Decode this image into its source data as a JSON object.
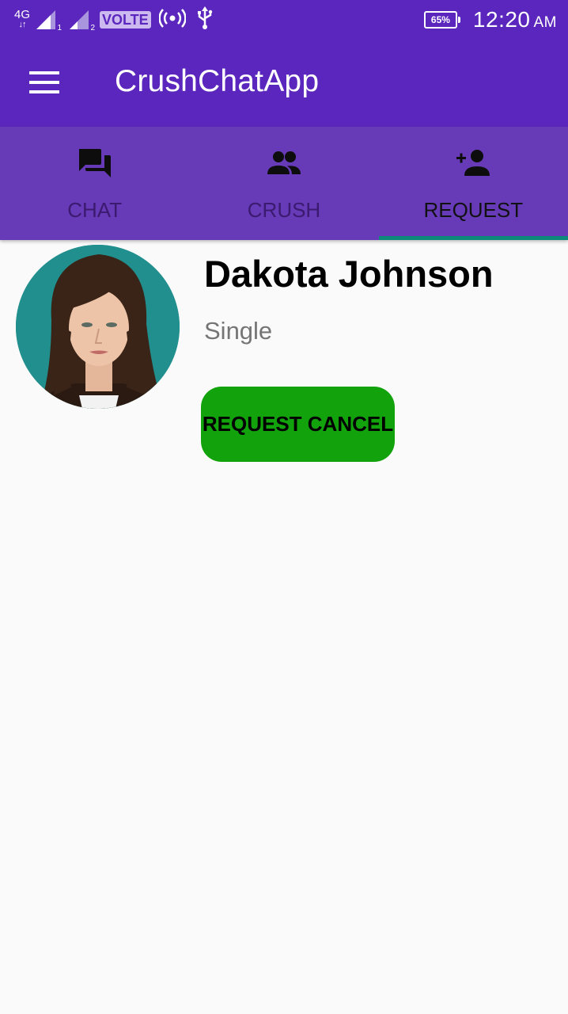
{
  "statusbar": {
    "network": "4G",
    "network_arrows": "↓↑",
    "sim1": "1",
    "sim2": "2",
    "volte": "VOLTE",
    "battery": "65%",
    "time": "12:20",
    "ampm": "AM"
  },
  "appbar": {
    "title": "CrushChatApp",
    "menu_icon": "hamburger-menu-icon"
  },
  "tabs": [
    {
      "label": "CHAT",
      "icon": "chat-bubbles-icon",
      "active": false
    },
    {
      "label": "CRUSH",
      "icon": "people-icon",
      "active": false
    },
    {
      "label": "REQUEST",
      "icon": "person-add-icon",
      "active": true
    }
  ],
  "request": {
    "name": "Dakota Johnson",
    "status": "Single",
    "button_label": "REQUEST CANCEL"
  },
  "colors": {
    "primary_dark": "#5b26bd",
    "primary": "#673ab7",
    "tab_indicator": "#0e8a7a",
    "button_green": "#12a20c",
    "background": "#fafafa"
  }
}
